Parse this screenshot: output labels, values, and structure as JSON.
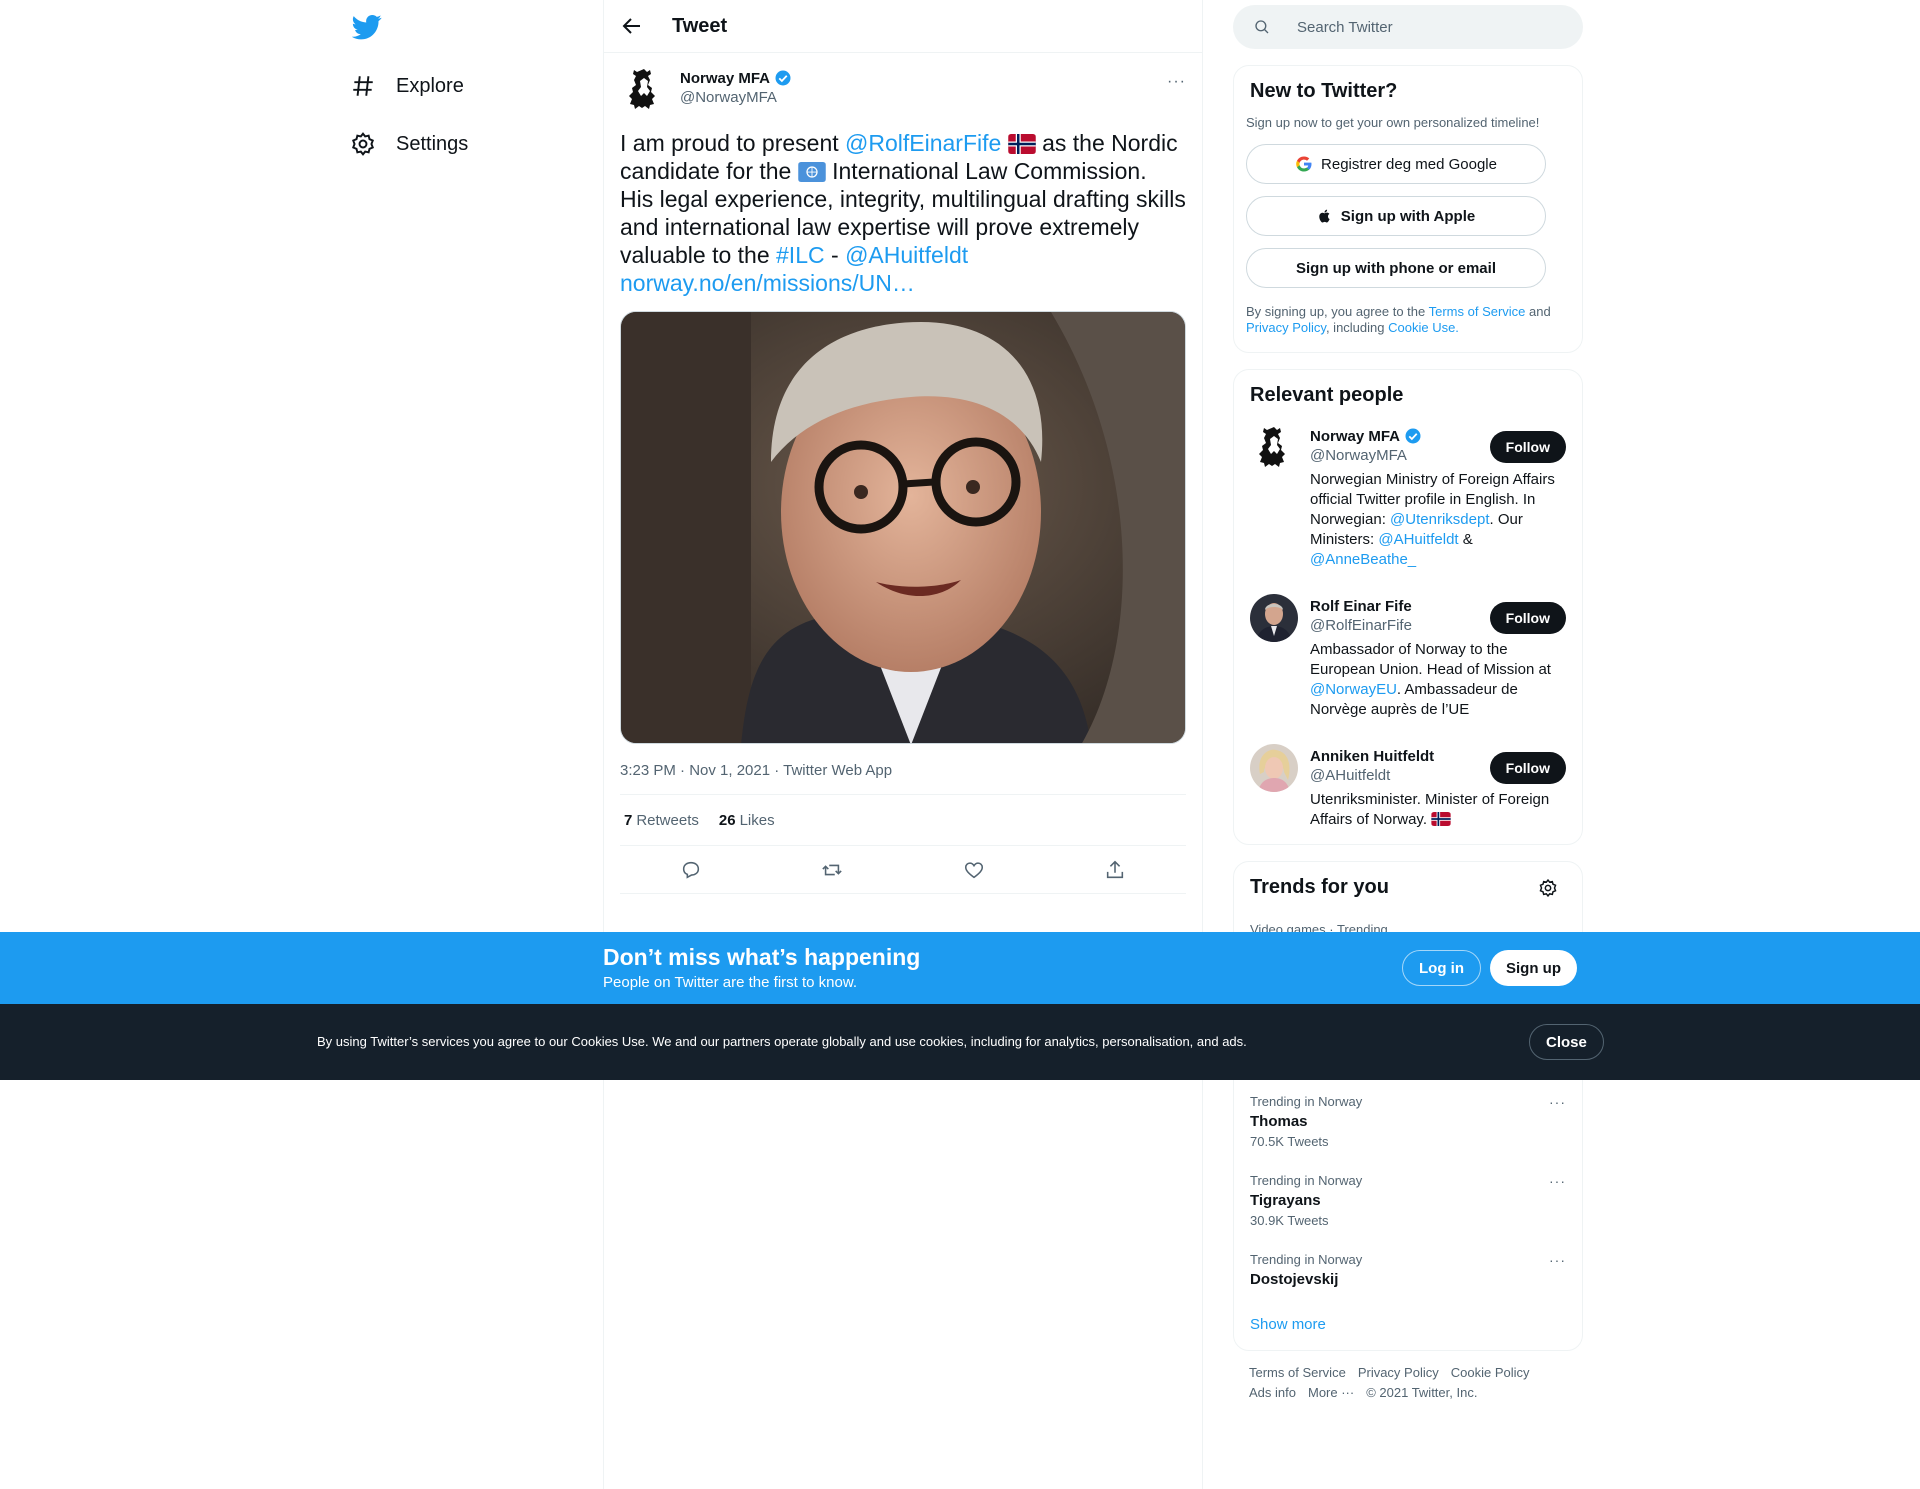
{
  "nav": {
    "explore": "Explore",
    "settings": "Settings"
  },
  "header": {
    "title": "Tweet"
  },
  "tweet": {
    "display_name": "Norway MFA",
    "username": "@NorwayMFA",
    "more": "···",
    "text": {
      "p1": "I am proud to present ",
      "mention1": "@RolfEinarFife",
      "p2": " as the Nordic candidate for the ",
      "p3": " International Law Commission. His legal experience, integrity, multilingual drafting skills and international law expertise will prove extremely valuable to the ",
      "hashtag": "#ILC",
      "p4": " - ",
      "mention2": "@AHuitfeldt",
      "url": "norway.no/en/missions/UN…"
    },
    "timestamp": "3:23 PM · Nov 1, 2021 · Twitter Web App",
    "retweets_count": "7",
    "retweets_label": "Retweets",
    "likes_count": "26",
    "likes_label": "Likes"
  },
  "search": {
    "placeholder": "Search Twitter"
  },
  "new_to_twitter": {
    "title": "New to Twitter?",
    "subtitle": "Sign up now to get your own personalized timeline!",
    "google": "Registrer deg med Google",
    "apple": "Sign up with Apple",
    "phone": "Sign up with phone or email",
    "legal_p1": "By signing up, you agree to the ",
    "tos": "Terms of Service",
    "legal_and": " and",
    "privacy": "Privacy Policy",
    "legal_inc": ", including ",
    "cookie": "Cookie Use."
  },
  "relevant_people": {
    "title": "Relevant people",
    "follow_label": "Follow",
    "people": [
      {
        "name": "Norway MFA",
        "handle": "@NorwayMFA",
        "bio_p1": "Norwegian Ministry of Foreign Affairs official Twitter profile in English. In Norwegian: ",
        "bio_m1": "@Utenriksdept",
        "bio_p2": ". Our Ministers: ",
        "bio_m2": "@AHuitfeldt",
        "bio_p3": " & ",
        "bio_m3": "@AnneBeathe_"
      },
      {
        "name": "Rolf Einar Fife",
        "handle": "@RolfEinarFife",
        "bio_p1": "Ambassador of Norway to the European Union. Head of Mission at ",
        "bio_m1": "@NorwayEU",
        "bio_p2": ". Ambassadeur de Norvège auprès de l’UE"
      },
      {
        "name": "Anniken Huitfeldt",
        "handle": "@AHuitfeldt",
        "bio_p1": "Utenriksminister. Minister of Foreign Affairs of Norway. "
      }
    ]
  },
  "trends": {
    "title": "Trends for you",
    "hidden_context": "Video games · Trending",
    "items": [
      {
        "context": "Trending in Norway",
        "name": "Thomas",
        "count": "70.5K Tweets"
      },
      {
        "context": "Trending in Norway",
        "name": "Tigrayans",
        "count": "30.9K Tweets"
      },
      {
        "context": "Trending in Norway",
        "name": "Dostojevskij",
        "count": ""
      }
    ],
    "show_more": "Show more"
  },
  "footer": {
    "tos": "Terms of Service",
    "privacy": "Privacy Policy",
    "cookie": "Cookie Policy",
    "ads": "Ads info",
    "more": "More ···",
    "copyright": "© 2021 Twitter, Inc."
  },
  "banner": {
    "title": "Don’t miss what’s happening",
    "subtitle": "People on Twitter are the first to know.",
    "login": "Log in",
    "signup": "Sign up"
  },
  "cookie_bar": {
    "text": "By using Twitter’s services you agree to our Cookies Use. We and our partners operate globally and use cookies, including for analytics, personalisation, and ads.",
    "close": "Close"
  },
  "colors": {
    "accent": "#1d9bf0",
    "dark": "#0f1419",
    "cookie_bg": "#15202b"
  }
}
